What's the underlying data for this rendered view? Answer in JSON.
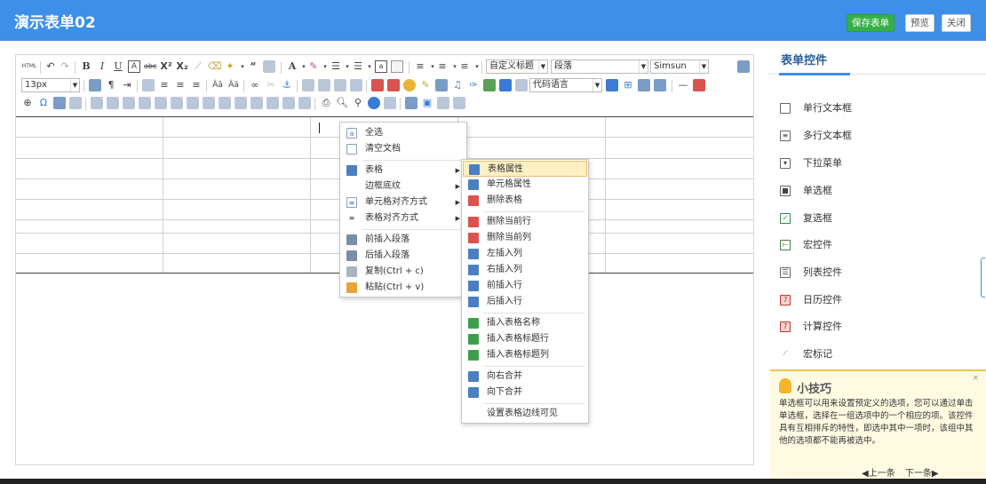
{
  "header": {
    "title": "演示表单02",
    "save_label": "保存表单",
    "preview_label": "预览",
    "close_label": "关闭"
  },
  "toolbar": {
    "html_label": "HTML",
    "font_size": "13px",
    "heading": "自定义标题",
    "paragraph": "段落",
    "font_family": "Simsun",
    "code_language": "代码语言"
  },
  "context_menu": {
    "items": [
      {
        "label": "全选",
        "icon": "select-all-icon"
      },
      {
        "label": "清空文档",
        "icon": "clear-doc-icon"
      },
      {
        "label": "表格",
        "icon": "table-icon",
        "submenu": true
      },
      {
        "label": "边框底纹",
        "icon": "",
        "submenu": true
      },
      {
        "label": "单元格对齐方式",
        "icon": "cell-align-icon",
        "submenu": true
      },
      {
        "label": "表格对齐方式",
        "icon": "table-align-icon",
        "submenu": true
      },
      {
        "label": "前插入段落",
        "icon": "insert-paragraph-before-icon"
      },
      {
        "label": "后插入段落",
        "icon": "insert-paragraph-after-icon"
      },
      {
        "label": "复制(Ctrl + c)",
        "icon": "copy-icon"
      },
      {
        "label": "粘贴(Ctrl + v)",
        "icon": "paste-icon"
      }
    ]
  },
  "table_submenu": {
    "items": [
      {
        "label": "表格属性",
        "icon": "table-properties-icon"
      },
      {
        "label": "单元格属性",
        "icon": "cell-properties-icon"
      },
      {
        "label": "删除表格",
        "icon": "delete-table-icon"
      },
      {
        "label": "删除当前行",
        "icon": "delete-row-icon"
      },
      {
        "label": "删除当前列",
        "icon": "delete-column-icon"
      },
      {
        "label": "左插入列",
        "icon": "insert-column-left-icon"
      },
      {
        "label": "右插入列",
        "icon": "insert-column-right-icon"
      },
      {
        "label": "前插入行",
        "icon": "insert-row-before-icon"
      },
      {
        "label": "后插入行",
        "icon": "insert-row-after-icon"
      },
      {
        "label": "插入表格名称",
        "icon": "insert-caption-icon"
      },
      {
        "label": "插入表格标题行",
        "icon": "insert-title-row-icon"
      },
      {
        "label": "插入表格标题列",
        "icon": "insert-title-column-icon"
      },
      {
        "label": "向右合并",
        "icon": "merge-right-icon"
      },
      {
        "label": "向下合并",
        "icon": "merge-down-icon"
      },
      {
        "label": "设置表格边线可见",
        "icon": ""
      }
    ]
  },
  "panel": {
    "title": "表单控件",
    "controls": [
      {
        "label": "单行文本框",
        "icon": "text-input-icon"
      },
      {
        "label": "多行文本框",
        "icon": "textarea-icon"
      },
      {
        "label": "下拉菜单",
        "icon": "dropdown-icon"
      },
      {
        "label": "单选框",
        "icon": "radio-icon"
      },
      {
        "label": "复选框",
        "icon": "checkbox-icon"
      },
      {
        "label": "宏控件",
        "icon": "macro-icon"
      },
      {
        "label": "列表控件",
        "icon": "list-icon"
      },
      {
        "label": "日历控件",
        "icon": "calendar-icon"
      },
      {
        "label": "计算控件",
        "icon": "calculator-icon"
      },
      {
        "label": "宏标记",
        "icon": "wand-icon"
      }
    ]
  },
  "tips": {
    "title": "小技巧",
    "close": "×",
    "text": "单选框可以用来设置预定义的选项，您可以通过单击单选框，选择在一组选项中的一个相应的项。该控件具有互相排斥的特性，即选中其中一项时，该组中其他的选项都不能再被选中。",
    "prev": "◀上一条",
    "next": "下一条▶"
  }
}
